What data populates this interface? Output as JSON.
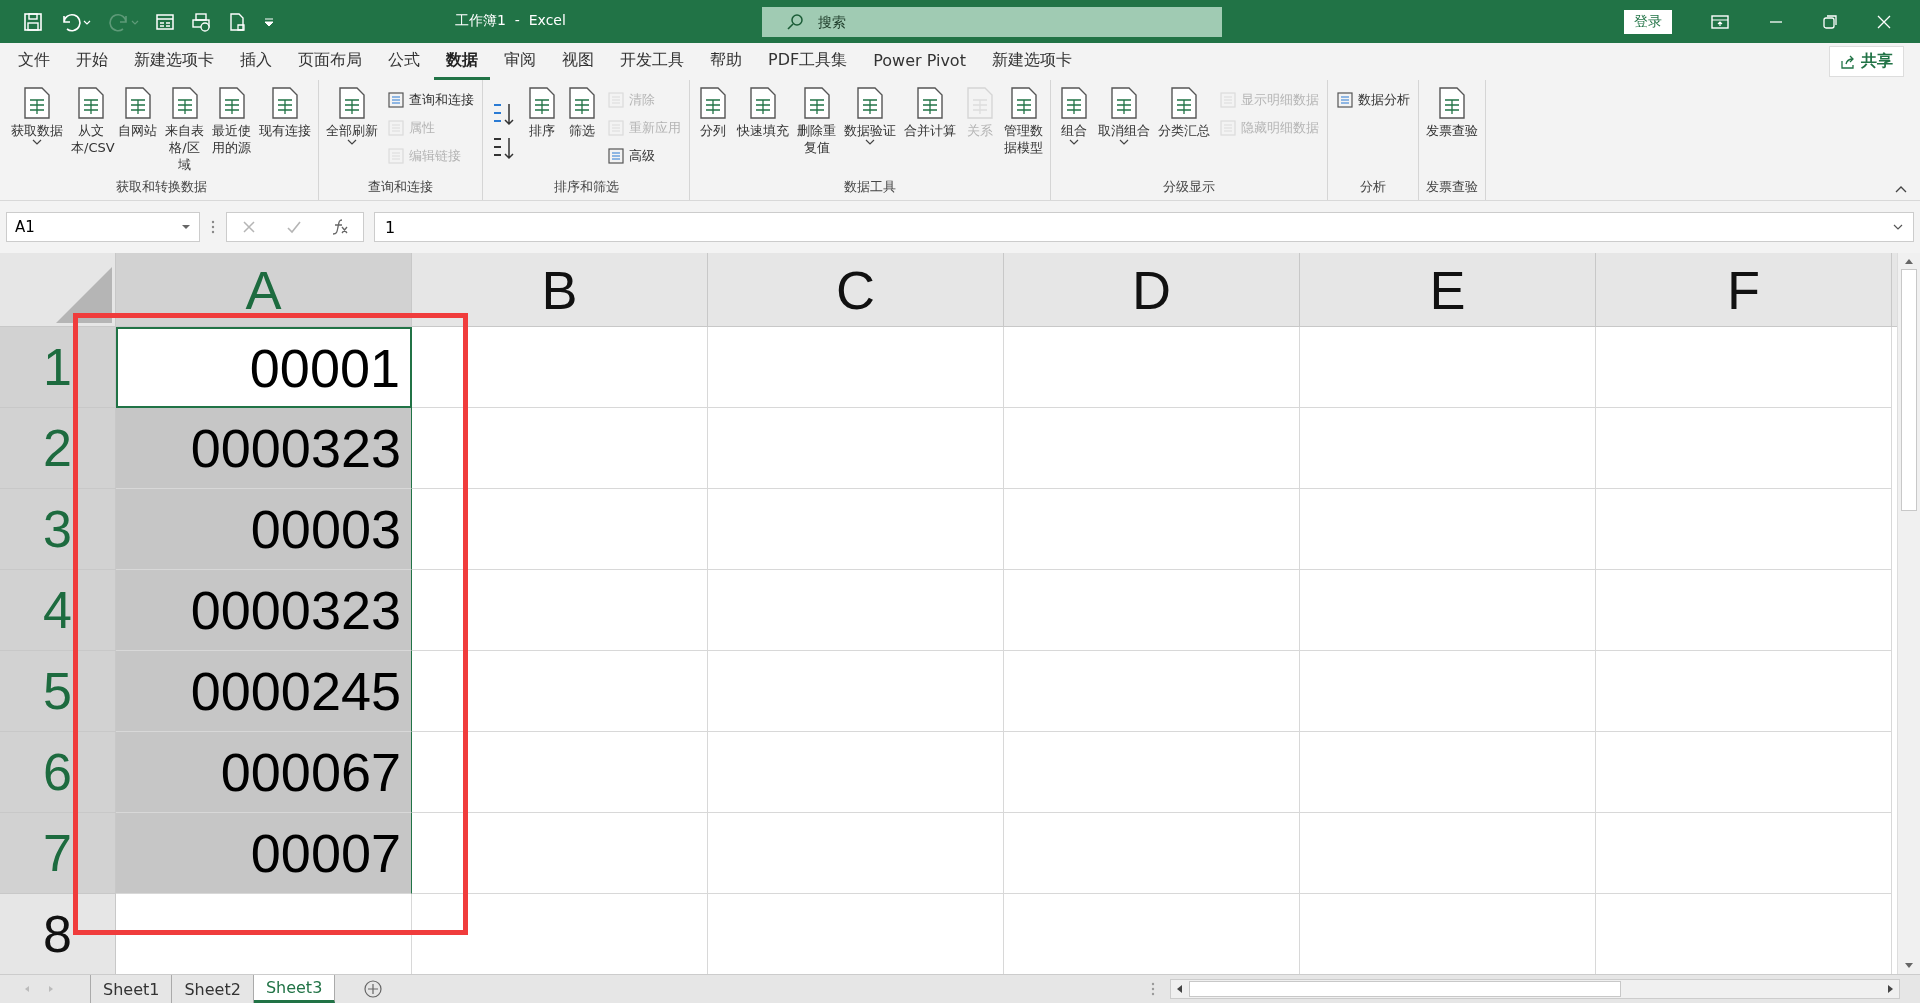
{
  "title_bar": {
    "title": "工作簿1  -  Excel",
    "search": {
      "placeholder": "搜索"
    },
    "login": "登录"
  },
  "menu_tabs": [
    {
      "label": "文件",
      "selected": false
    },
    {
      "label": "开始",
      "selected": false
    },
    {
      "label": "新建选项卡",
      "selected": false
    },
    {
      "label": "插入",
      "selected": false
    },
    {
      "label": "页面布局",
      "selected": false
    },
    {
      "label": "公式",
      "selected": false
    },
    {
      "label": "数据",
      "selected": true
    },
    {
      "label": "审阅",
      "selected": false
    },
    {
      "label": "视图",
      "selected": false
    },
    {
      "label": "开发工具",
      "selected": false
    },
    {
      "label": "帮助",
      "selected": false
    },
    {
      "label": "PDF工具集",
      "selected": false
    },
    {
      "label": "Power Pivot",
      "selected": false
    },
    {
      "label": "新建选项卡",
      "selected": false
    }
  ],
  "share": "共享",
  "ribbon_groups": [
    {
      "label": "获取和转换数据",
      "items": [
        {
          "kind": "large",
          "label": "获取数据",
          "dropdown": true,
          "disabled": false
        },
        {
          "kind": "large",
          "label": "从文本/CSV",
          "dropdown": false,
          "disabled": false
        },
        {
          "kind": "large",
          "label": "自网站",
          "dropdown": false,
          "disabled": false
        },
        {
          "kind": "large",
          "label": "来自表格/区域",
          "dropdown": false,
          "disabled": false
        },
        {
          "kind": "large",
          "label": "最近使用的源",
          "dropdown": false,
          "disabled": false
        },
        {
          "kind": "large",
          "label": "现有连接",
          "dropdown": false,
          "disabled": false
        }
      ]
    },
    {
      "label": "查询和连接",
      "items": [
        {
          "kind": "large",
          "label": "全部刷新",
          "dropdown": true,
          "disabled": false
        },
        {
          "kind": "small",
          "label": "查询和连接",
          "disabled": false
        },
        {
          "kind": "small",
          "label": "属性",
          "disabled": true
        },
        {
          "kind": "small",
          "label": "编辑链接",
          "disabled": true
        }
      ]
    },
    {
      "label": "排序和筛选",
      "items": [
        {
          "kind": "sort"
        },
        {
          "kind": "large",
          "label": "排序",
          "dropdown": false,
          "disabled": false
        },
        {
          "kind": "large",
          "label": "筛选",
          "dropdown": false,
          "disabled": false
        },
        {
          "kind": "small",
          "label": "清除",
          "disabled": true
        },
        {
          "kind": "small",
          "label": "重新应用",
          "disabled": true
        },
        {
          "kind": "small",
          "label": "高级",
          "disabled": false
        }
      ]
    },
    {
      "label": "数据工具",
      "items": [
        {
          "kind": "large",
          "label": "分列",
          "dropdown": false,
          "disabled": false
        },
        {
          "kind": "large",
          "label": "快速填充",
          "dropdown": false,
          "disabled": false
        },
        {
          "kind": "large",
          "label": "删除重复值",
          "dropdown": false,
          "disabled": false
        },
        {
          "kind": "large",
          "label": "数据验证",
          "dropdown": true,
          "disabled": false
        },
        {
          "kind": "large",
          "label": "合并计算",
          "dropdown": false,
          "disabled": false
        },
        {
          "kind": "large",
          "label": "关系",
          "dropdown": false,
          "disabled": true
        },
        {
          "kind": "large",
          "label": "管理数据模型",
          "dropdown": false,
          "disabled": false
        }
      ]
    },
    {
      "label": "分级显示",
      "items": [
        {
          "kind": "large",
          "label": "组合",
          "dropdown": true,
          "disabled": false
        },
        {
          "kind": "large",
          "label": "取消组合",
          "dropdown": true,
          "disabled": false
        },
        {
          "kind": "large",
          "label": "分类汇总",
          "dropdown": false,
          "disabled": false
        },
        {
          "kind": "small",
          "label": "显示明细数据",
          "disabled": true
        },
        {
          "kind": "small",
          "label": "隐藏明细数据",
          "disabled": true
        }
      ]
    },
    {
      "label": "分析",
      "items": [
        {
          "kind": "small",
          "label": "数据分析",
          "disabled": false
        }
      ]
    },
    {
      "label": "发票查验",
      "items": [
        {
          "kind": "large",
          "label": "发票查验",
          "dropdown": false,
          "disabled": false
        }
      ]
    }
  ],
  "formula_bar": {
    "name_box": "A1",
    "formula": "1"
  },
  "columns": [
    {
      "label": "A",
      "selected": true
    },
    {
      "label": "B",
      "selected": false
    },
    {
      "label": "C",
      "selected": false
    },
    {
      "label": "D",
      "selected": false
    },
    {
      "label": "E",
      "selected": false
    },
    {
      "label": "F",
      "selected": false
    }
  ],
  "rows": [
    {
      "label": "1",
      "selected": true,
      "active": true,
      "value": "00001"
    },
    {
      "label": "2",
      "selected": true,
      "active": false,
      "value": "0000323"
    },
    {
      "label": "3",
      "selected": true,
      "active": false,
      "value": "00003"
    },
    {
      "label": "4",
      "selected": true,
      "active": false,
      "value": "0000323"
    },
    {
      "label": "5",
      "selected": true,
      "active": false,
      "value": "0000245"
    },
    {
      "label": "6",
      "selected": true,
      "active": false,
      "value": "000067"
    },
    {
      "label": "7",
      "selected": true,
      "active": false,
      "value": "00007"
    },
    {
      "label": "8",
      "selected": false,
      "active": false,
      "value": ""
    }
  ],
  "sheet_tabs": [
    {
      "label": "Sheet1",
      "selected": false
    },
    {
      "label": "Sheet2",
      "selected": false
    },
    {
      "label": "Sheet3",
      "selected": true
    }
  ]
}
